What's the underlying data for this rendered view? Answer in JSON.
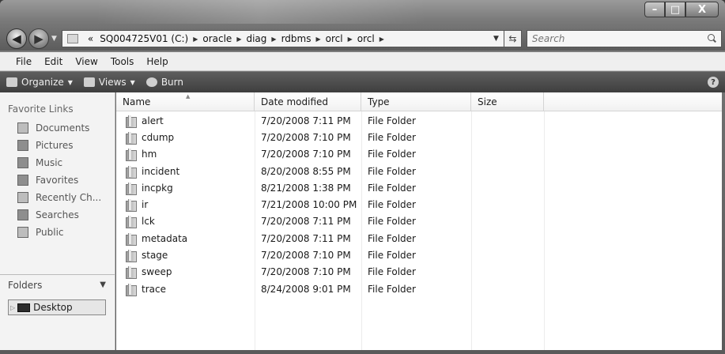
{
  "window": {
    "caption_buttons": {
      "minimize": "–",
      "maximize": "□",
      "close": "X"
    }
  },
  "nav": {
    "back_glyph": "◀",
    "forward_glyph": "▶",
    "address": {
      "overflow": "«",
      "crumbs": [
        "SQ004725V01 (C:)",
        "oracle",
        "diag",
        "rdbms",
        "orcl",
        "orcl"
      ],
      "separator": "▶"
    },
    "search": {
      "placeholder": "Search"
    }
  },
  "menubar": {
    "file": "File",
    "edit": "Edit",
    "view": "View",
    "tools": "Tools",
    "help": "Help"
  },
  "cmdbar": {
    "organize": "Organize",
    "views": "Views",
    "burn": "Burn",
    "help_glyph": "?"
  },
  "navpane": {
    "title": "Favorite Links",
    "favorites": [
      {
        "label": "Documents",
        "icon": "documents-icon"
      },
      {
        "label": "Pictures",
        "icon": "pictures-icon"
      },
      {
        "label": "Music",
        "icon": "music-icon"
      },
      {
        "label": "Favorites",
        "icon": "favorites-icon"
      },
      {
        "label": "Recently Ch...",
        "icon": "recent-icon"
      },
      {
        "label": "Searches",
        "icon": "searches-icon"
      },
      {
        "label": "Public",
        "icon": "public-icon"
      }
    ],
    "folders_label": "Folders",
    "tree_root": "Desktop"
  },
  "filelist": {
    "columns": {
      "name": "Name",
      "date": "Date modified",
      "type": "Type",
      "size": "Size"
    },
    "rows": [
      {
        "name": "alert",
        "date": "7/20/2008 7:11 PM",
        "type": "File Folder",
        "size": ""
      },
      {
        "name": "cdump",
        "date": "7/20/2008 7:10 PM",
        "type": "File Folder",
        "size": ""
      },
      {
        "name": "hm",
        "date": "7/20/2008 7:10 PM",
        "type": "File Folder",
        "size": ""
      },
      {
        "name": "incident",
        "date": "8/20/2008 8:55 PM",
        "type": "File Folder",
        "size": ""
      },
      {
        "name": "incpkg",
        "date": "8/21/2008 1:38 PM",
        "type": "File Folder",
        "size": ""
      },
      {
        "name": "ir",
        "date": "7/21/2008 10:00 PM",
        "type": "File Folder",
        "size": ""
      },
      {
        "name": "lck",
        "date": "7/20/2008 7:11 PM",
        "type": "File Folder",
        "size": ""
      },
      {
        "name": "metadata",
        "date": "7/20/2008 7:11 PM",
        "type": "File Folder",
        "size": ""
      },
      {
        "name": "stage",
        "date": "7/20/2008 7:10 PM",
        "type": "File Folder",
        "size": ""
      },
      {
        "name": "sweep",
        "date": "7/20/2008 7:10 PM",
        "type": "File Folder",
        "size": ""
      },
      {
        "name": "trace",
        "date": "8/24/2008 9:01 PM",
        "type": "File Folder",
        "size": ""
      }
    ]
  }
}
